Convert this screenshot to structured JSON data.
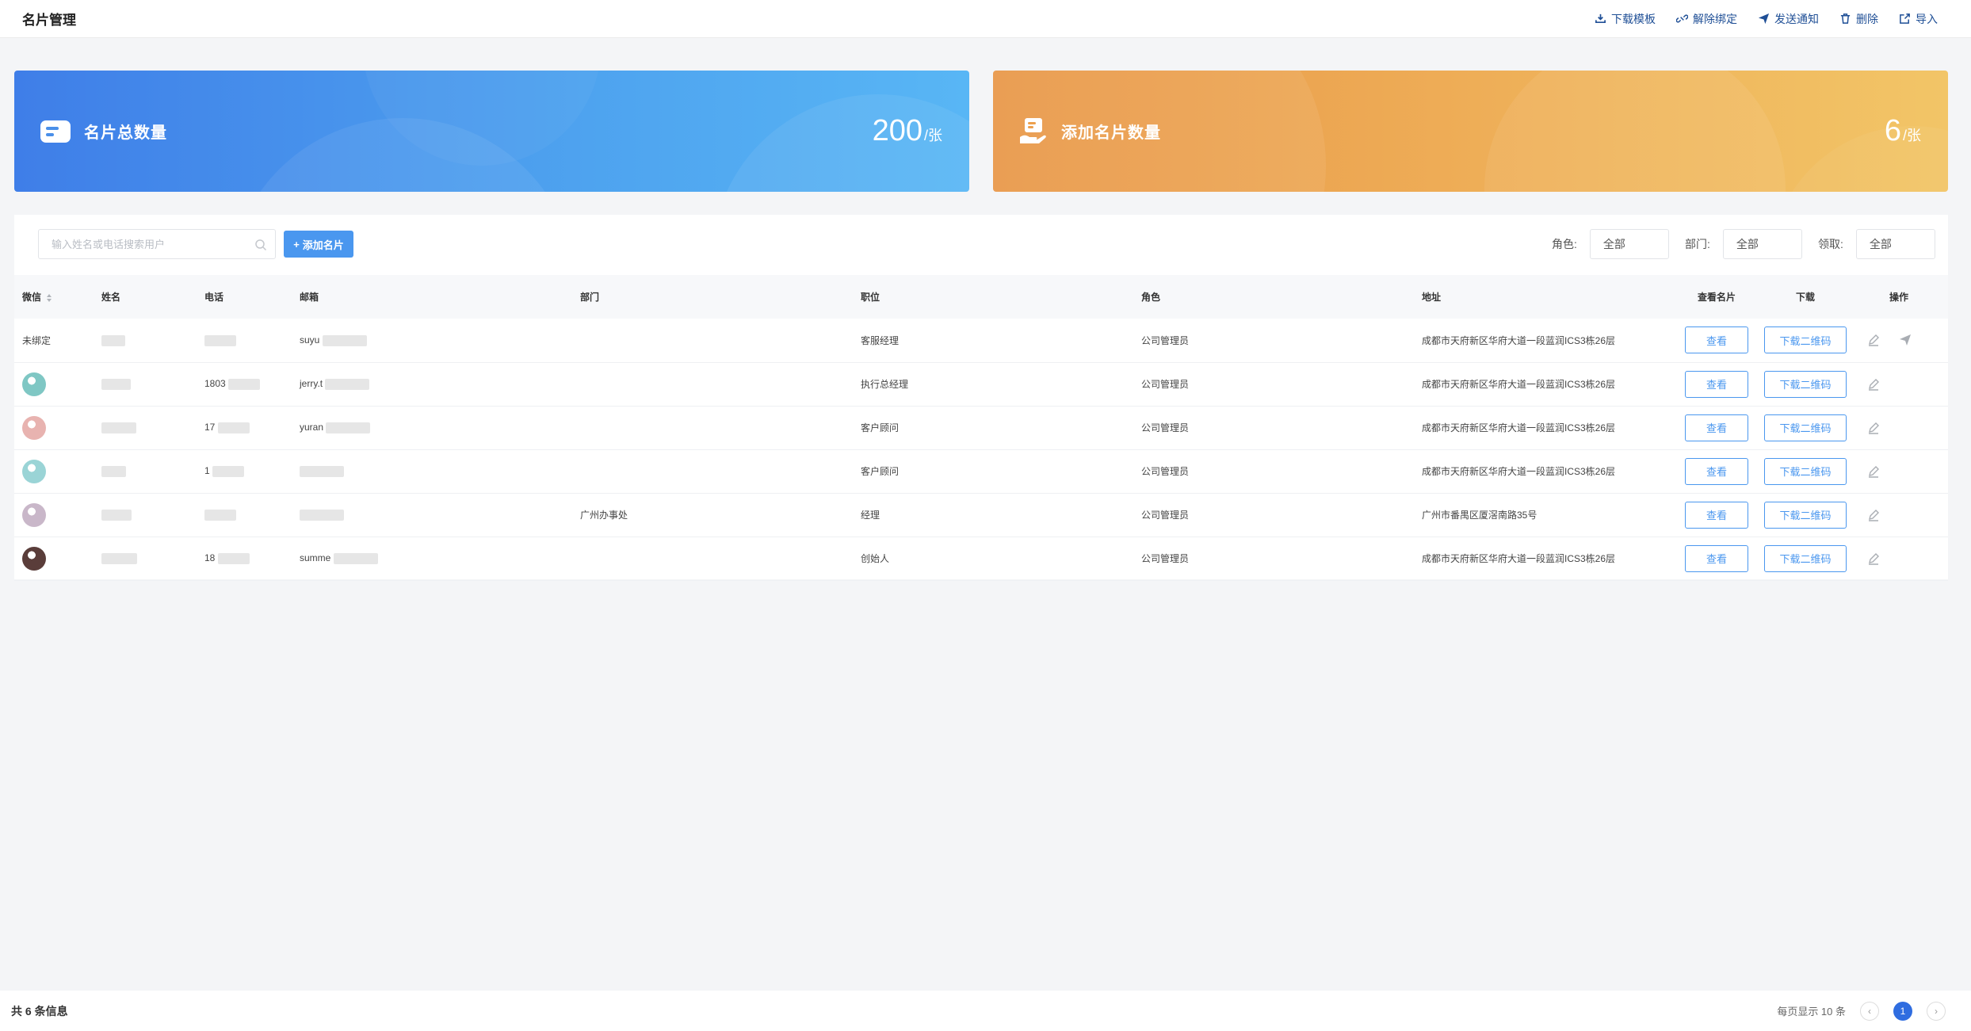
{
  "header": {
    "title": "名片管理",
    "actions": [
      {
        "label": "下载模板",
        "icon": "download-icon"
      },
      {
        "label": "解除绑定",
        "icon": "unlink-icon"
      },
      {
        "label": "发送通知",
        "icon": "send-icon"
      },
      {
        "label": "删除",
        "icon": "trash-icon"
      },
      {
        "label": "导入",
        "icon": "import-icon"
      }
    ]
  },
  "stats": [
    {
      "label": "名片总数量",
      "value": "200",
      "unit": "/张",
      "icon": "card-icon",
      "color": "#4a97ef"
    },
    {
      "label": "添加名片数量",
      "value": "6",
      "unit": "/张",
      "icon": "add-card-hand-icon",
      "color": "#eea24f"
    }
  ],
  "toolbar": {
    "search_placeholder": "输入姓名或电话搜索用户",
    "add_label": "添加名片",
    "filters": [
      {
        "label": "角色:",
        "value": "全部"
      },
      {
        "label": "部门:",
        "value": "全部"
      },
      {
        "label": "领取:",
        "value": "全部"
      }
    ]
  },
  "table": {
    "headers": [
      "微信",
      "姓名",
      "电话",
      "邮箱",
      "部门",
      "职位",
      "角色",
      "地址",
      "查看名片",
      "下载",
      "操作"
    ],
    "view_label": "查看",
    "download_label": "下载二维码",
    "rows": [
      {
        "wechat": "未绑定",
        "name": "",
        "phone": "",
        "email": "suyu",
        "dept": "",
        "position": "客服经理",
        "role": "公司管理员",
        "address": "成都市天府新区华府大道一段蓝润ICS3栋26层",
        "has_send": true
      },
      {
        "wechat": "",
        "name": "",
        "phone": "1803",
        "email": "jerry.t",
        "dept": "",
        "position": "执行总经理",
        "role": "公司管理员",
        "address": "成都市天府新区华府大道一段蓝润ICS3栋26层",
        "has_send": false
      },
      {
        "wechat": "",
        "name": "",
        "phone": "17",
        "email": "yuran",
        "dept": "",
        "position": "客户顾问",
        "role": "公司管理员",
        "address": "成都市天府新区华府大道一段蓝润ICS3栋26层",
        "has_send": false
      },
      {
        "wechat": "",
        "name": "",
        "phone": "1",
        "email": "",
        "dept": "",
        "position": "客户顾问",
        "role": "公司管理员",
        "address": "成都市天府新区华府大道一段蓝润ICS3栋26层",
        "has_send": false
      },
      {
        "wechat": "",
        "name": "",
        "phone": "",
        "email": "",
        "dept": "广州办事处",
        "position": "经理",
        "role": "公司管理员",
        "address": "广州市番禺区厦滘南路35号",
        "has_send": false
      },
      {
        "wechat": "",
        "name": "",
        "phone": "18",
        "email": "summe",
        "dept": "",
        "position": "创始人",
        "role": "公司管理员",
        "address": "成都市天府新区华府大道一段蓝润ICS3栋26层",
        "has_send": false
      }
    ]
  },
  "footer": {
    "total": "共 6 条信息",
    "page_size": "每页显示 10 条",
    "current_page": "1",
    "prev": "‹",
    "next": "›"
  }
}
